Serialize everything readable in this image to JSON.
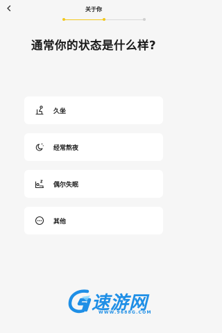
{
  "header": {
    "title": "关于你",
    "back_icon": "chevron-left-icon",
    "progress": {
      "current_step": 2,
      "total_steps": 3,
      "accent": "#f2c81e"
    }
  },
  "question": "通常你的状态是什么样?",
  "options": [
    {
      "label": "久坐",
      "icon": "sitting-person-icon"
    },
    {
      "label": "经常熬夜",
      "icon": "moon-stars-icon"
    },
    {
      "label": "偶尔失眠",
      "icon": "sleeping-person-icon"
    },
    {
      "label": "其他",
      "icon": "ellipsis-circle-icon"
    }
  ],
  "watermark": {
    "brand": "速游网",
    "url": "WWW.9688G.COM",
    "color": "#1f8fe6"
  },
  "colors": {
    "background": "#f6f6f6",
    "card": "#ffffff",
    "accent": "#f2c81e"
  }
}
